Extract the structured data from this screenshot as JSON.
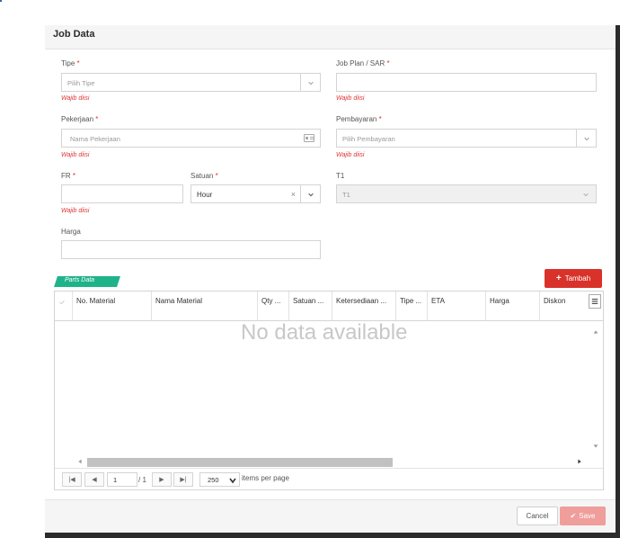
{
  "modal": {
    "title": "Job Data"
  },
  "form": {
    "tipe": {
      "label": "Tipe",
      "placeholder": "Pilih Tipe",
      "error": "Wajib diisi"
    },
    "job_plan": {
      "label": "Job Plan / SAR",
      "value": "",
      "error": "Wajib diisi"
    },
    "pekerjaan": {
      "label": "Pekerjaan",
      "placeholder": "Nama Pekerjaan",
      "error": "Wajib diisi"
    },
    "pembayaran": {
      "label": "Pembayaran",
      "placeholder": "Pilih Pembayaran",
      "error": "Wajib diisi"
    },
    "fr": {
      "label": "FR",
      "value": "",
      "error": "Wajib diisi"
    },
    "satuan": {
      "label": "Satuan",
      "value": "Hour"
    },
    "t1": {
      "label": "T1",
      "value": "T1"
    },
    "harga": {
      "label": "Harga",
      "value": ""
    },
    "required_mark": "*"
  },
  "parts": {
    "tag": "Parts Data",
    "add_button": "Tambah",
    "columns": [
      "No. Material",
      "Nama Material",
      "Qty ...",
      "Satuan ...",
      "Ketersediaan ...",
      "Tipe ...",
      "ETA",
      "Harga",
      "Diskon"
    ],
    "empty_text": "No data available",
    "pager": {
      "page": "1",
      "of": "/ 1",
      "per_page": "250",
      "per_page_label": "items per page"
    }
  },
  "footer": {
    "cancel": "Cancel",
    "save": "Save"
  },
  "colors": {
    "danger": "#d9322b",
    "accent_green": "#1fb38a",
    "save_disabled": "#ef9e9b"
  }
}
